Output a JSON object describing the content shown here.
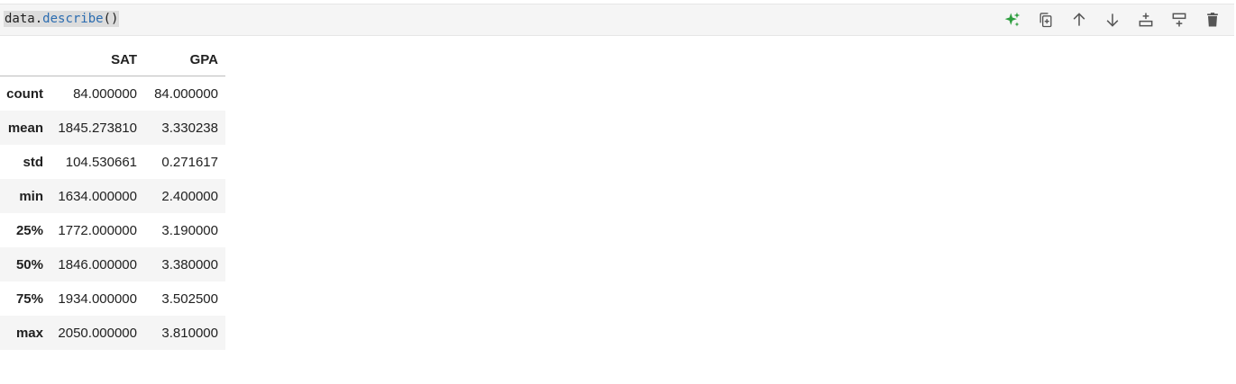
{
  "cell": {
    "code_prefix": "data.",
    "code_fn": "describe",
    "code_suffix": "()",
    "toolbar": [
      {
        "name": "sparkle-icon",
        "title": "AI assist"
      },
      {
        "name": "duplicate-icon",
        "title": "Duplicate cell"
      },
      {
        "name": "arrow-up-icon",
        "title": "Move up"
      },
      {
        "name": "arrow-down-icon",
        "title": "Move down"
      },
      {
        "name": "insert-above-icon",
        "title": "Insert cell above"
      },
      {
        "name": "insert-below-icon",
        "title": "Insert cell below"
      },
      {
        "name": "trash-icon",
        "title": "Delete cell"
      }
    ],
    "accent_color": "#2e9e3f"
  },
  "output": {
    "columns": [
      "",
      "SAT",
      "GPA"
    ],
    "rows": [
      {
        "label": "count",
        "sat": "84.000000",
        "gpa": "84.000000"
      },
      {
        "label": "mean",
        "sat": "1845.273810",
        "gpa": "3.330238"
      },
      {
        "label": "std",
        "sat": "104.530661",
        "gpa": "0.271617"
      },
      {
        "label": "min",
        "sat": "1634.000000",
        "gpa": "2.400000"
      },
      {
        "label": "25%",
        "sat": "1772.000000",
        "gpa": "3.190000"
      },
      {
        "label": "50%",
        "sat": "1846.000000",
        "gpa": "3.380000"
      },
      {
        "label": "75%",
        "sat": "1934.000000",
        "gpa": "3.502500"
      },
      {
        "label": "max",
        "sat": "2050.000000",
        "gpa": "3.810000"
      }
    ]
  }
}
